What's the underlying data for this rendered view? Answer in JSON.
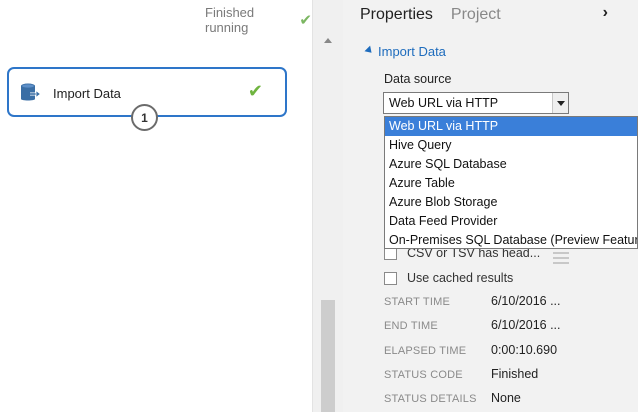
{
  "canvas": {
    "run_status": "Finished running",
    "module": {
      "title": "Import Data",
      "port_number": "1"
    }
  },
  "panel": {
    "tabs": [
      "Properties",
      "Project"
    ],
    "active_tab": "Properties",
    "section_title": "Import Data",
    "data_source_label": "Data source",
    "data_source_value": "Web URL via HTTP",
    "dropdown_options": [
      "Web URL via HTTP",
      "Hive Query",
      "Azure SQL Database",
      "Azure Table",
      "Azure Blob Storage",
      "Data Feed Provider",
      "On-Premises SQL Database (Preview Feature)"
    ],
    "csv_header_label": "CSV or TSV has head...",
    "use_cached_label": "Use cached results",
    "stats": [
      {
        "label": "START TIME",
        "value": "6/10/2016 ..."
      },
      {
        "label": "END TIME",
        "value": "6/10/2016 ..."
      },
      {
        "label": "ELAPSED TIME",
        "value": "0:00:10.690"
      },
      {
        "label": "STATUS CODE",
        "value": "Finished"
      },
      {
        "label": "STATUS DETAILS",
        "value": "None"
      }
    ]
  },
  "colors": {
    "accent": "#1e6cbd",
    "selection": "#3a7fd9",
    "success": "#6fb43f"
  }
}
